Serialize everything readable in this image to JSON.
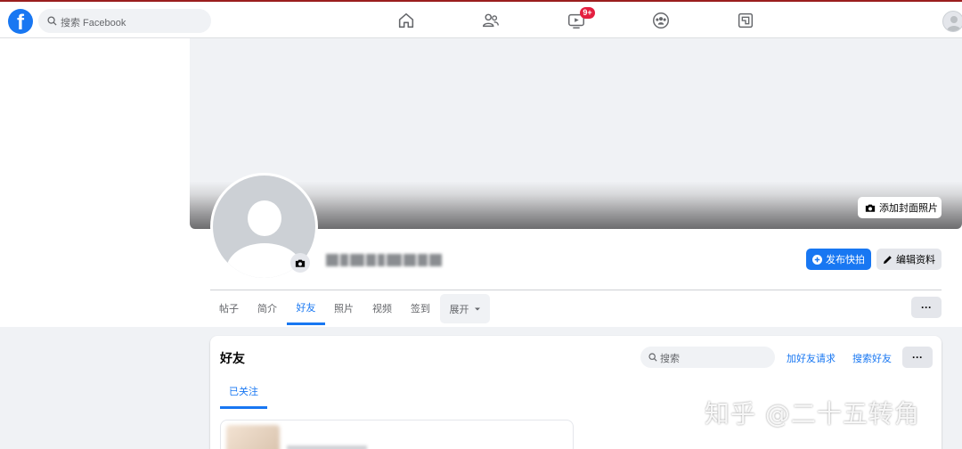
{
  "header": {
    "logo": "f",
    "search_placeholder": "搜索 Facebook",
    "watch_badge": "9+",
    "nav_icons": [
      "home-icon",
      "friends-icon",
      "watch-icon",
      "groups-icon",
      "gaming-icon"
    ]
  },
  "cover": {
    "add_cover_label": "添加封面照片"
  },
  "profile": {
    "primary_action": "发布快拍",
    "secondary_action": "编辑资料"
  },
  "tabs": [
    {
      "label": "帖子"
    },
    {
      "label": "简介"
    },
    {
      "label": "好友",
      "active": true
    },
    {
      "label": "照片"
    },
    {
      "label": "视频"
    },
    {
      "label": "签到"
    },
    {
      "label": "展开"
    }
  ],
  "tabs_more_label": "···",
  "friends_card": {
    "title": "好友",
    "search_placeholder": "搜索",
    "friend_requests_label": "加好友请求",
    "find_friends_label": "搜索好友",
    "more_label": "···",
    "subtab_label": "已关注"
  },
  "watermark": "知乎 @二十五转角",
  "colors": {
    "brand": "#1877f2",
    "badge": "#e41e3f",
    "page_bg": "#f0f2f5"
  }
}
